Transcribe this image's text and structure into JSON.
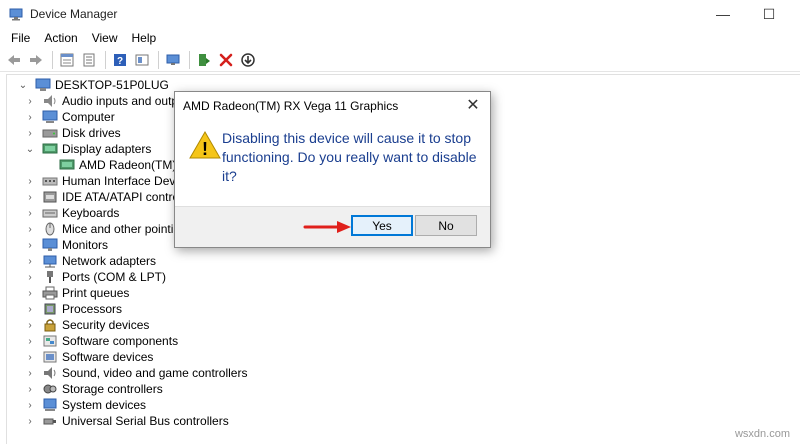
{
  "window": {
    "title": "Device Manager",
    "minimize_glyph": "—",
    "maximize_glyph": "☐"
  },
  "menu": {
    "items": [
      "File",
      "Action",
      "View",
      "Help"
    ]
  },
  "toolbar": {
    "icons": [
      "back-arrow-icon",
      "forward-arrow-icon",
      "properties-icon",
      "list-icon",
      "help-icon",
      "view-icon",
      "monitor-icon",
      "update-driver-icon",
      "uninstall-icon",
      "disable-device-icon"
    ]
  },
  "tree": {
    "expand_glyph": "›",
    "collapse_glyph": "⌄",
    "root": {
      "label": "DESKTOP-51P0LUG"
    },
    "items": [
      {
        "label": "Audio inputs and outputs",
        "icon": "audio-icon"
      },
      {
        "label": "Computer",
        "icon": "computer-icon"
      },
      {
        "label": "Disk drives",
        "icon": "disk-icon"
      },
      {
        "label": "Display adapters",
        "icon": "display-adapter-icon",
        "expanded": true,
        "children": [
          {
            "label": "AMD Radeon(TM) RX",
            "icon": "display-adapter-icon"
          }
        ]
      },
      {
        "label": "Human Interface Devices",
        "icon": "hid-icon"
      },
      {
        "label": "IDE ATA/ATAPI controllers",
        "icon": "ide-icon"
      },
      {
        "label": "Keyboards",
        "icon": "keyboard-icon"
      },
      {
        "label": "Mice and other pointing",
        "icon": "mouse-icon"
      },
      {
        "label": "Monitors",
        "icon": "monitor-icon"
      },
      {
        "label": "Network adapters",
        "icon": "network-icon"
      },
      {
        "label": "Ports (COM & LPT)",
        "icon": "port-icon"
      },
      {
        "label": "Print queues",
        "icon": "printer-icon"
      },
      {
        "label": "Processors",
        "icon": "processor-icon"
      },
      {
        "label": "Security devices",
        "icon": "security-icon"
      },
      {
        "label": "Software components",
        "icon": "software-component-icon"
      },
      {
        "label": "Software devices",
        "icon": "software-device-icon"
      },
      {
        "label": "Sound, video and game controllers",
        "icon": "sound-icon"
      },
      {
        "label": "Storage controllers",
        "icon": "storage-icon"
      },
      {
        "label": "System devices",
        "icon": "system-icon"
      },
      {
        "label": "Universal Serial Bus controllers",
        "icon": "usb-icon"
      }
    ]
  },
  "dialog": {
    "title": "AMD Radeon(TM) RX Vega 11 Graphics",
    "close_glyph": "✕",
    "message": "Disabling this device will cause it to stop functioning. Do you really want to disable it?",
    "yes_label": "Yes",
    "no_label": "No",
    "warning_glyph": "!"
  },
  "watermark": "wsxdn.com",
  "colors": {
    "message_text": "#1a3e8f",
    "focus_border": "#0078d7",
    "warning_fill": "#f5c518",
    "arrow_red": "#e0201b"
  }
}
